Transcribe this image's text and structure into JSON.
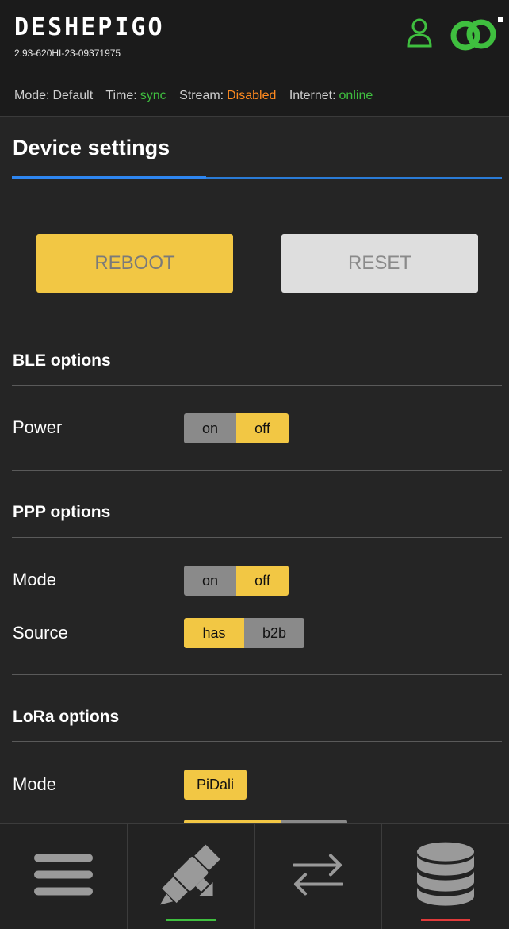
{
  "header": {
    "brand": "DESHEPIGO",
    "serial": "2.93-620HI-23-09371975",
    "icons": {
      "user": "user-icon",
      "link": "link-icon"
    },
    "status": [
      {
        "label": "Mode:",
        "value": "Default",
        "color": "#cfcfcf"
      },
      {
        "label": "Time:",
        "value": "sync",
        "color": "#3fbf3f"
      },
      {
        "label": "Stream:",
        "value": "Disabled",
        "color": "#ff8a1f"
      },
      {
        "label": "Internet:",
        "value": "online",
        "color": "#3fbf3f"
      }
    ]
  },
  "page": {
    "title": "Device settings",
    "reboot_label": "REBOOT",
    "reset_label": "RESET"
  },
  "ble": {
    "title": "BLE options",
    "power": {
      "label": "Power",
      "on": "on",
      "off": "off",
      "selected": "off"
    }
  },
  "ppp": {
    "title": "PPP options",
    "mode": {
      "label": "Mode",
      "on": "on",
      "off": "off",
      "selected": "off"
    },
    "source": {
      "label": "Source",
      "opt1": "has",
      "opt2": "b2b",
      "selected": "has"
    }
  },
  "lora": {
    "title": "LoRa options",
    "mode": {
      "label": "Mode",
      "value": "PiDali"
    }
  },
  "nav": {
    "items": [
      {
        "icon": "menu-icon",
        "indicator": ""
      },
      {
        "icon": "satellite-icon",
        "indicator": "#3fbf3f"
      },
      {
        "icon": "transfer-arrows-icon",
        "indicator": ""
      },
      {
        "icon": "database-icon",
        "indicator": "#e03a3a"
      }
    ]
  },
  "colors": {
    "accent": "#2e86f0",
    "yellow": "#f2c744",
    "grey": "#8a8a8a"
  }
}
